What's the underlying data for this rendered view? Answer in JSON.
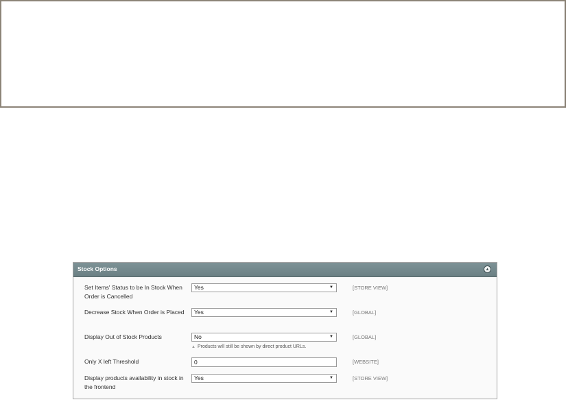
{
  "panel": {
    "title": "Stock Options",
    "collapse_icon": "chevron-up-icon"
  },
  "fields": [
    {
      "label": "Set Items' Status to be In Stock When Order is Cancelled",
      "value": "Yes",
      "scope": "[STORE VIEW]"
    },
    {
      "label": "Decrease Stock When Order is Placed",
      "value": "Yes",
      "scope": "[GLOBAL]"
    },
    {
      "label": "Display Out of Stock Products",
      "value": "No",
      "scope": "[GLOBAL]",
      "note": "Products will still be shown by direct product URLs."
    },
    {
      "label": "Only X left Threshold",
      "value": "0",
      "scope": "[WEBSITE]"
    },
    {
      "label": "Display products availability in stock in the frontend",
      "value": "Yes",
      "scope": "[STORE VIEW]"
    }
  ]
}
